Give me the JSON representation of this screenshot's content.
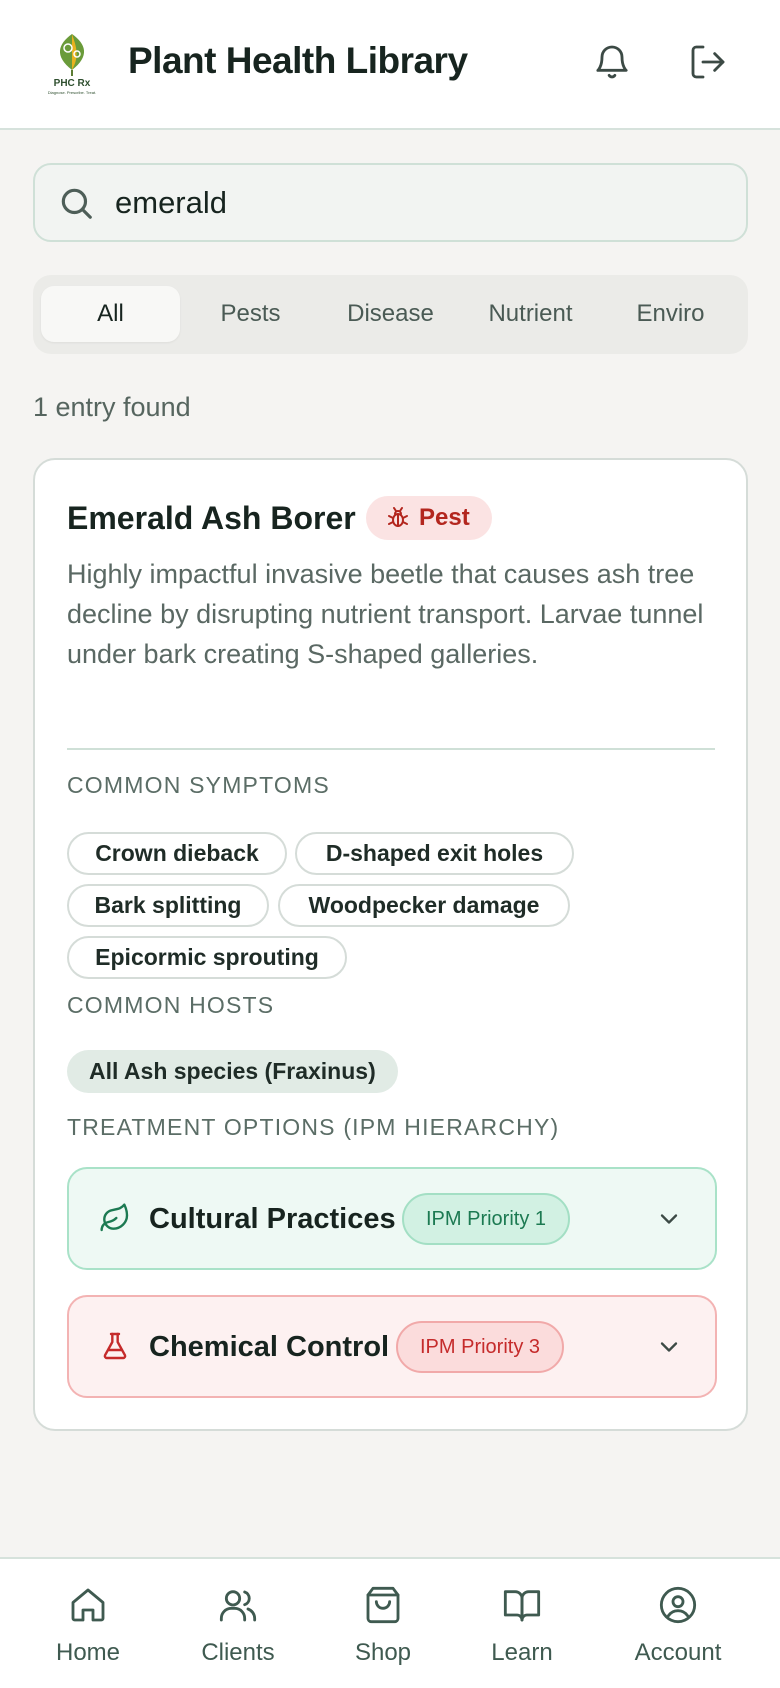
{
  "header": {
    "title": "Plant Health Library",
    "logo_text": "PHC Rx",
    "logo_tagline": "Diagnose. Prescribe. Treat.",
    "icons": [
      "bell-icon",
      "logout-icon"
    ]
  },
  "search": {
    "value": "emerald",
    "placeholder": "Search"
  },
  "tabs": [
    {
      "label": "All",
      "active": true
    },
    {
      "label": "Pests",
      "active": false
    },
    {
      "label": "Disease",
      "active": false
    },
    {
      "label": "Nutrient",
      "active": false
    },
    {
      "label": "Enviro",
      "active": false
    }
  ],
  "results": {
    "count_text": "1 entry found"
  },
  "entry": {
    "title": "Emerald Ash Borer",
    "badge": "Pest",
    "description": "Highly impactful invasive beetle that causes ash tree decline by disrupting nutrient transport. Larvae tunnel under bark creating S-shaped galleries.",
    "symptoms_label": "COMMON SYMPTOMS",
    "symptoms": [
      "Crown dieback",
      "D-shaped exit holes",
      "Bark splitting",
      "Woodpecker damage",
      "Epicormic sprouting"
    ],
    "hosts_label": "COMMON HOSTS",
    "hosts": [
      "All Ash species (Fraxinus)"
    ],
    "treatments_label": "TREATMENT OPTIONS (IPM HIERARCHY)",
    "treatments": [
      {
        "label": "Cultural Practices",
        "priority": "IPM Priority 1",
        "icon": "leaf-icon",
        "color": "#1c7a52"
      },
      {
        "label": "Chemical Control",
        "priority": "IPM Priority 3",
        "icon": "flask-icon",
        "color": "#c52b2b"
      }
    ]
  },
  "bottom_nav": [
    {
      "label": "Home",
      "icon": "home-icon"
    },
    {
      "label": "Clients",
      "icon": "users-icon"
    },
    {
      "label": "Shop",
      "icon": "shopping-bag-icon"
    },
    {
      "label": "Learn",
      "icon": "book-icon"
    },
    {
      "label": "Account",
      "icon": "user-circle-icon"
    }
  ],
  "colors": {
    "accent": "#3f5a50",
    "pest_red": "#b3261e",
    "background": "#f5f4f2"
  }
}
